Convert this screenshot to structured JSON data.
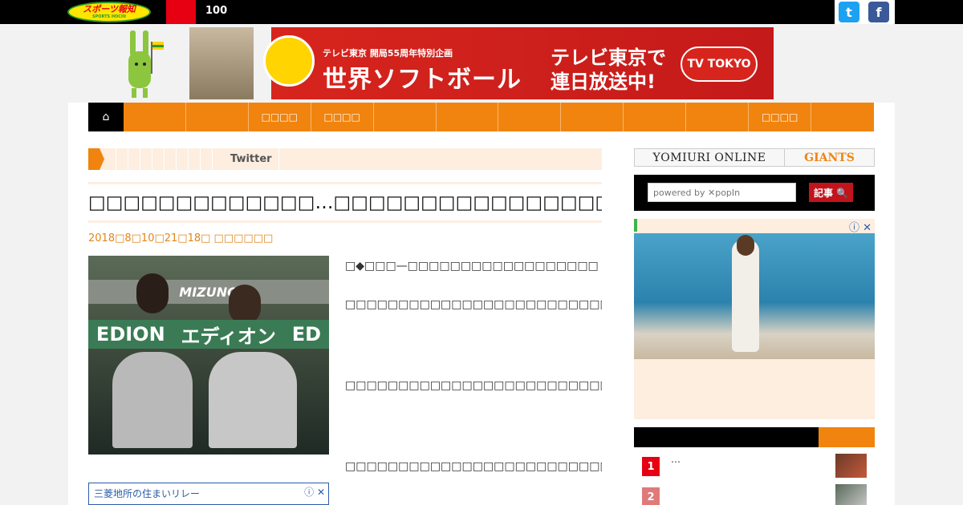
{
  "topbar": {
    "logo_main": "スポーツ報知",
    "logo_sub": "SPORTS HOCHI",
    "count": "100",
    "twitter_glyph": "t",
    "facebook_glyph": "f"
  },
  "banner": {
    "small_text": "テレビ東京 開局55周年特別企画",
    "title": "世界ソフトボール",
    "right_line1": "テレビ東京で",
    "right_line2": "連日放送中!",
    "tv_logo": "TV TOKYO"
  },
  "nav": {
    "home_glyph": "⌂",
    "items": [
      "",
      "",
      "□□□□",
      "□□□□",
      "",
      "",
      "",
      "",
      "",
      "",
      "□□□□",
      ""
    ]
  },
  "breadcrumb": {
    "twitter_label": "Twitter"
  },
  "article": {
    "headline": "□□□□□□□□□□□□□…□□□□□□□□□□□□□□□□",
    "date": "2018□8□10□21□18□  □□□□□□",
    "photo_banner": "エディオン",
    "photo_banner_left": "EDION",
    "photo_banner_right": "ED",
    "photo_sign": "MIZUNO",
    "paragraphs": [
      "□◆□□□—□□□□□□□□□□□□□□□□□□",
      "□□□□□□□□□□□□□□□□□□□□□□□□□□□□□□□□□□□□□□□□□□□□□□□□□□□□□□□□□□□□□□“□□”□□□□□□□□□□□□□□□□□□□□□□□□□□□□□□",
      "□□□□□□□□□□□□□□□□□□□□□□□□□□□□□□□□□□□□□□□□□□□□□□□□□□□□□□□□□□□□□□□□□□□□□□□□□□□",
      "□□□□□□□□□□□□□□□□□□□□□□□□□□□□□□□□□□□□□□□□□□□□□□□□□□□□□□□□□□□□□□□□"
    ],
    "ad_text": "三菱地所の住まいリレー",
    "ad_info": "ⓘ ✕"
  },
  "sidebar": {
    "yomiuri_label": "YOMIURI ONLINE",
    "giants_label": "GIANTS",
    "search_placeholder": "powered by ✕popIn",
    "search_button": "記事 🔍",
    "ad_info": "ⓘ ✕",
    "ranking": [
      {
        "rank": "1",
        "text": "…",
        "color": "#e60012"
      },
      {
        "rank": "2",
        "text": "",
        "color": "#e07a7a"
      }
    ]
  },
  "colors": {
    "accent_orange": "#f0840f",
    "brand_red": "#e60012",
    "twitter_blue": "#1da1f2",
    "facebook_blue": "#3b5998"
  }
}
